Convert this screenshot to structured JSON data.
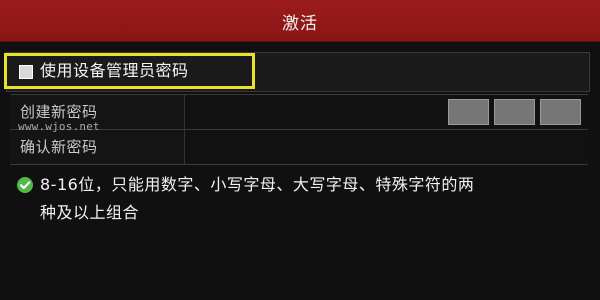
{
  "title": "激活",
  "checkbox": {
    "label": "使用设备管理员密码",
    "checked": false
  },
  "form": {
    "create_password_label": "创建新密码",
    "confirm_password_label": "确认新密码",
    "create_password_value": "",
    "confirm_password_value": ""
  },
  "watermark": "www.wjos.net",
  "tip": {
    "icon": "check-circle-icon",
    "text": "8-16位，只能用数字、小写字母、大写字母、特殊字符的两\n种及以上组合"
  },
  "colors": {
    "header": "#8f1717",
    "highlight": "#e8e22a",
    "tip_icon": "#53b84a"
  }
}
